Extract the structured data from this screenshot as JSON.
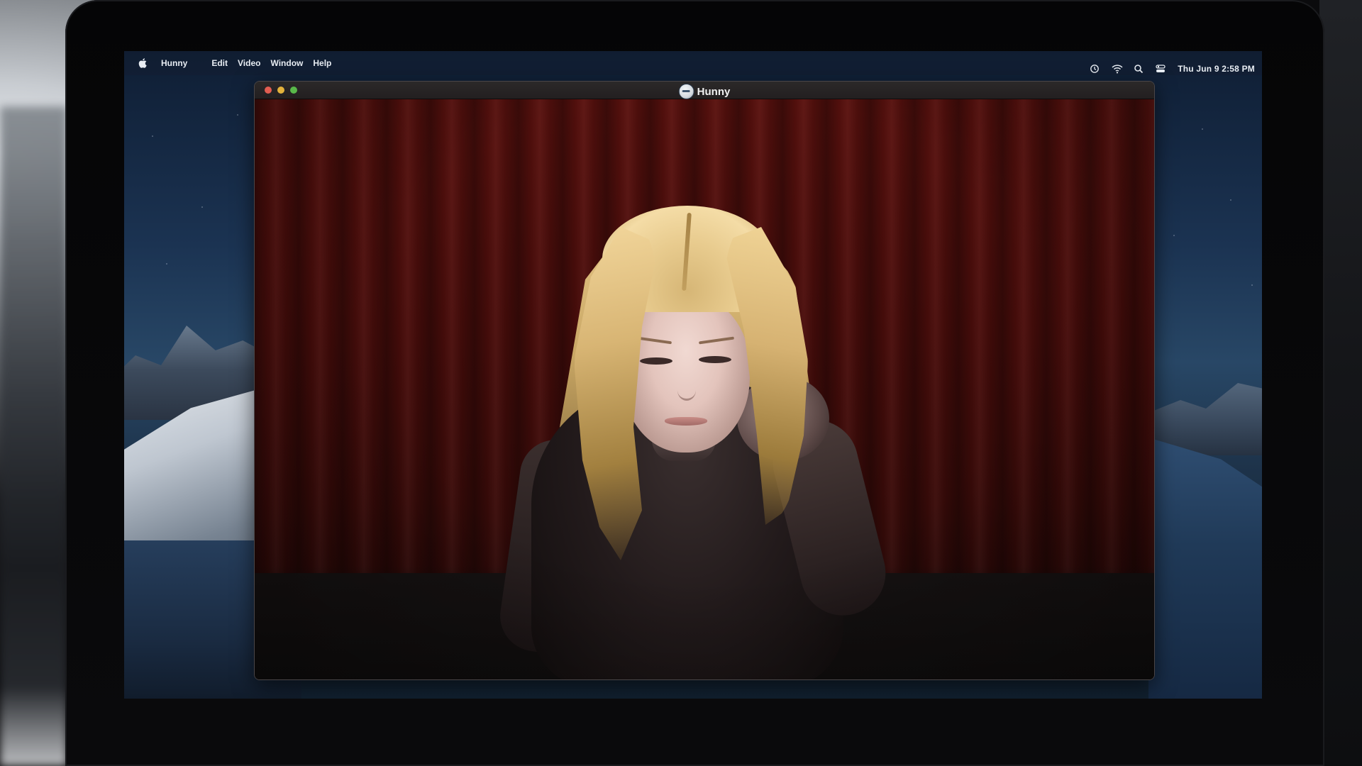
{
  "menubar": {
    "app_name": "Hunny",
    "menus": [
      {
        "label": "Edit"
      },
      {
        "label": "Video"
      },
      {
        "label": "Window"
      },
      {
        "label": "Help"
      }
    ],
    "status_icons": [
      "time-machine-icon",
      "wifi-icon",
      "spotlight-search-icon",
      "control-center-icon"
    ],
    "clock": "Thu Jun 9  2:58 PM"
  },
  "window": {
    "title": "Hunny",
    "logo_icon": "hunny-logo-icon",
    "traffic_lights": {
      "close": "#e25d51",
      "minimize": "#e3b23c",
      "maximize": "#59b84a"
    }
  },
  "colors": {
    "curtain": "#4a0d0b",
    "menubar_text": "#e8edf3",
    "titlebar": "#2b2929"
  }
}
